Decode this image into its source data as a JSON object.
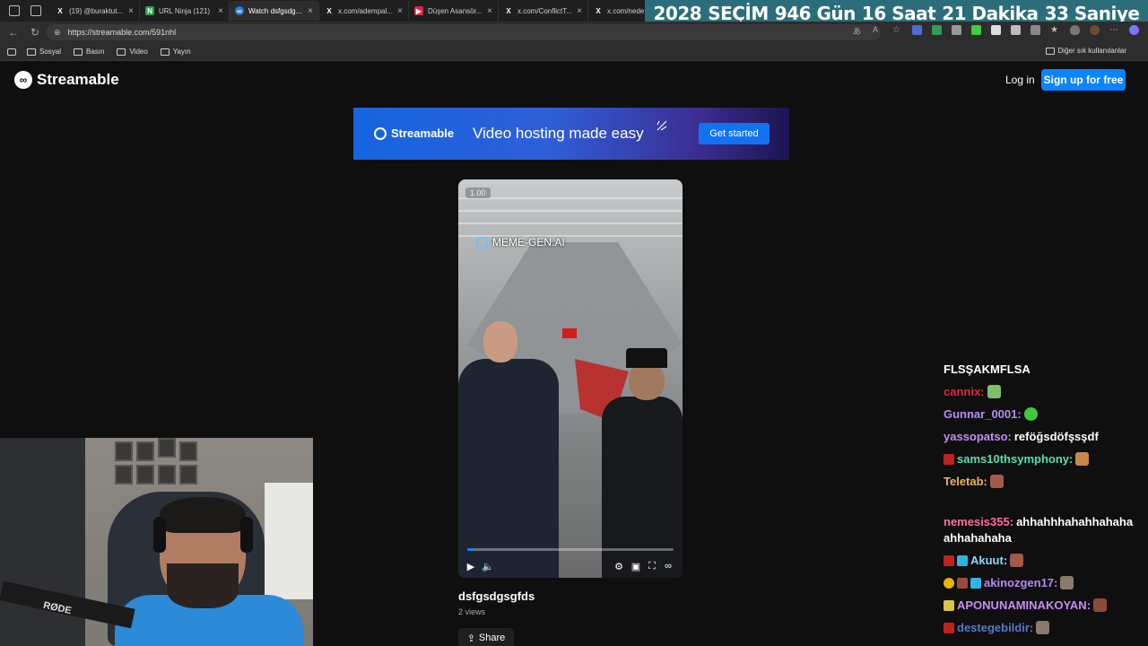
{
  "browser": {
    "tabs": [
      {
        "title": "(19) @buraktut...",
        "icon": "x-logo-icon"
      },
      {
        "title": "URL Ninja (121)",
        "icon": "ninja-icon"
      },
      {
        "title": "Watch dsfgsdg...",
        "icon": "streamable-icon",
        "active": true
      },
      {
        "title": "x.com/adempal...",
        "icon": "x-logo-icon"
      },
      {
        "title": "Düşen Asansör...",
        "icon": "youtube-icon"
      },
      {
        "title": "x.com/ConflictT...",
        "icon": "x-logo-icon"
      },
      {
        "title": "x.com/nedenti...",
        "icon": "x-logo-icon"
      }
    ],
    "url": "https://streamable.com/591nhl",
    "bookmarks": [
      "Sosyal",
      "Basın",
      "Video",
      "Yayın"
    ],
    "other_bookmarks": "Diğer sık kullanılanlar"
  },
  "countdown": {
    "year": "2028",
    "label": "SEÇİM",
    "days": "946 Gün",
    "hours": "16 Saat",
    "minutes": "21 Dakika",
    "seconds": "33 Saniye"
  },
  "site": {
    "logo": "Streamable",
    "login": "Log in",
    "signup": "Sign up for free"
  },
  "banner": {
    "logo": "Streamable",
    "tagline": "Video hosting made easy",
    "cta": "Get started"
  },
  "video": {
    "speed": "1.00",
    "watermark": "MEME-GEN.AI",
    "progress": 0.03,
    "title": "dsfgsdgsgfds",
    "views": "2 views",
    "share": "Share"
  },
  "chat": {
    "header": "FLSŞAKMFLSA",
    "messages": [
      {
        "user": "cannix:",
        "color": "#e0243b",
        "text": ""
      },
      {
        "user": "Gunnar_0001:",
        "color": "#b78af7",
        "text": ""
      },
      {
        "user": "yassopatso:",
        "color": "#c98cf2",
        "text": "reföğsdöfşsşdf"
      },
      {
        "user": "sams10thsymphony:",
        "color": "#56e0b4",
        "text": ""
      },
      {
        "user": "Teletab:",
        "color": "#f0b35b",
        "text": ""
      },
      {
        "user": "nemesis355:",
        "color": "#ff6da2",
        "text": "ahhahhhahahhahaha"
      },
      {
        "user": "",
        "color": "#ffffff",
        "text": "ahhahahaha"
      },
      {
        "user": "Akuut:",
        "color": "#8fd6ff",
        "text": ""
      },
      {
        "user": "akinozgen17:",
        "color": "#b78af7",
        "text": ""
      },
      {
        "user": "APONUNAMINAKOYAN:",
        "color": "#c98cf2",
        "text": ""
      },
      {
        "user": "destegebildir:",
        "color": "#5a78c8",
        "text": ""
      }
    ]
  },
  "webcam": {
    "mic_brand": "RØDE"
  }
}
